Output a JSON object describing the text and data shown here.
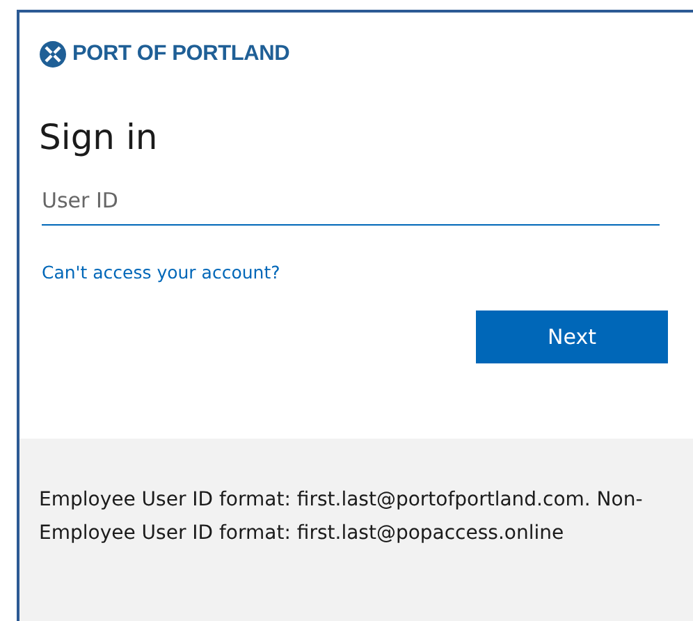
{
  "logo": {
    "text": "PORT OF PORTLAND"
  },
  "heading": "Sign in",
  "user_id_field": {
    "placeholder": "User ID"
  },
  "help_link": "Can't access your account?",
  "next_button": "Next",
  "footer_text": "Employee User ID format: first.last@portofportland.com. Non-Employee User ID format: first.last@popaccess.online"
}
